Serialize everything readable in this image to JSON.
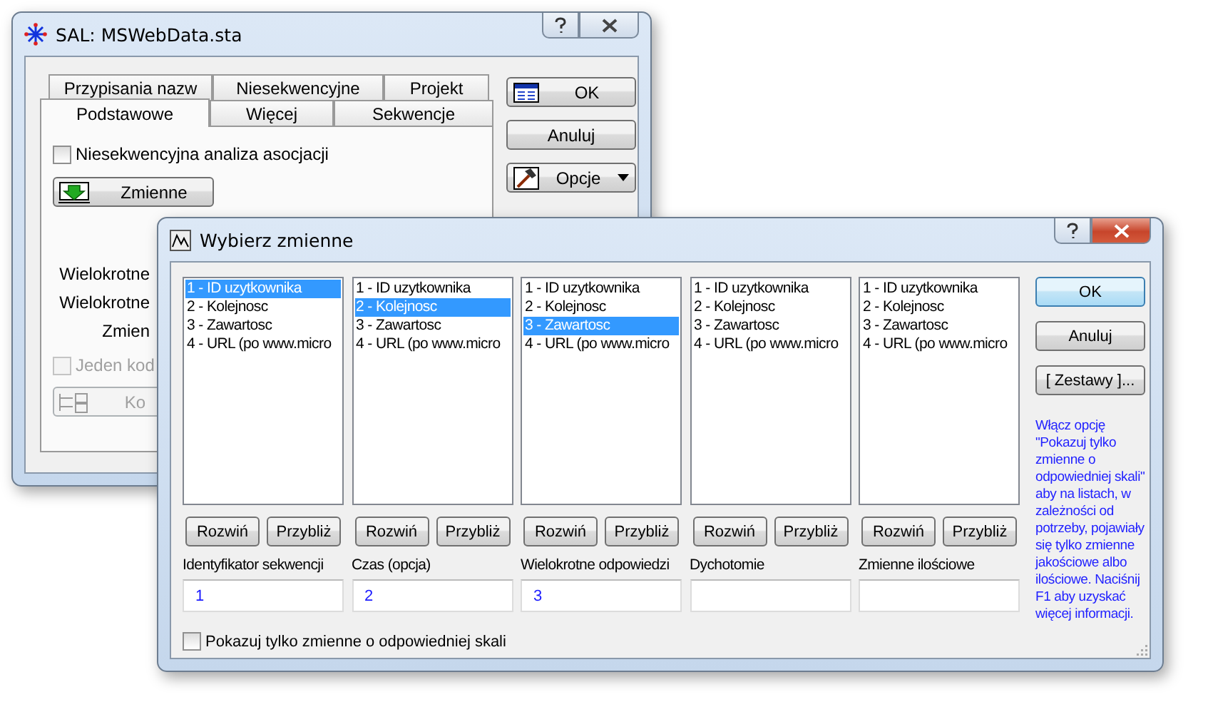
{
  "back_window": {
    "title": "SAL: MSWebData.sta",
    "tab_rows": [
      [
        {
          "label": "Przypisania nazw",
          "selected": false
        },
        {
          "label": "Niesekwencyjne",
          "selected": false
        },
        {
          "label": "Projekt",
          "selected": false
        }
      ],
      [
        {
          "label": "Podstawowe",
          "selected": true
        },
        {
          "label": "Więcej",
          "selected": false
        },
        {
          "label": "Sekwencje",
          "selected": false
        }
      ]
    ],
    "nonseq_checkbox": {
      "label": "Niesekwencyjna analiza asocjacji",
      "checked": false
    },
    "variables_button": {
      "label": "Zmienne"
    },
    "partial_labels": [
      "Wielokrotne",
      "Wielokrotne",
      "Zmien"
    ],
    "single_code_checkbox": {
      "label": "Jeden kod",
      "checked": false,
      "disabled": true
    },
    "code_button": {
      "label": "Ko",
      "disabled": true
    },
    "buttons": [
      {
        "label": "OK",
        "kind": "ok"
      },
      {
        "label": "Anuluj",
        "kind": "plain"
      },
      {
        "label": "Opcje",
        "kind": "dropdown"
      }
    ]
  },
  "front_window": {
    "title": "Wybierz zmienne",
    "lists": [
      {
        "items": [
          {
            "text": "1 - ID uzytkownika",
            "selected": true
          },
          {
            "text": "2 - Kolejnosc",
            "selected": false
          },
          {
            "text": "3 - Zawartosc",
            "selected": false
          },
          {
            "text": "4 - URL (po www.micro",
            "selected": false
          }
        ],
        "expand": "Rozwiń",
        "zoom": "Przybliż",
        "label": "Identyfikator sekwencji",
        "value": "1"
      },
      {
        "items": [
          {
            "text": "1 - ID uzytkownika",
            "selected": false
          },
          {
            "text": "2 - Kolejnosc",
            "selected": true
          },
          {
            "text": "3 - Zawartosc",
            "selected": false
          },
          {
            "text": "4 - URL (po www.micro",
            "selected": false
          }
        ],
        "expand": "Rozwiń",
        "zoom": "Przybliż",
        "label": "Czas (opcja)",
        "value": "2"
      },
      {
        "items": [
          {
            "text": "1 - ID uzytkownika",
            "selected": false
          },
          {
            "text": "2 - Kolejnosc",
            "selected": false
          },
          {
            "text": "3 - Zawartosc",
            "selected": true
          },
          {
            "text": "4 - URL (po www.micro",
            "selected": false
          }
        ],
        "expand": "Rozwiń",
        "zoom": "Przybliż",
        "label": "Wielokrotne odpowiedzi",
        "value": "3"
      },
      {
        "items": [
          {
            "text": "1 - ID uzytkownika",
            "selected": false
          },
          {
            "text": "2 - Kolejnosc",
            "selected": false
          },
          {
            "text": "3 - Zawartosc",
            "selected": false
          },
          {
            "text": "4 - URL (po www.micro",
            "selected": false
          }
        ],
        "expand": "Rozwiń",
        "zoom": "Przybliż",
        "label": "Dychotomie"
      },
      {
        "items": [
          {
            "text": "1 - ID uzytkownika",
            "selected": false
          },
          {
            "text": "2 - Kolejnosc",
            "selected": false
          },
          {
            "text": "3 - Zawartosc",
            "selected": false
          },
          {
            "text": "4 - URL (po www.micro",
            "selected": false
          }
        ],
        "expand": "Rozwiń",
        "zoom": "Przybliż",
        "label": "Zmienne ilościowe"
      }
    ],
    "scale_checkbox": {
      "label": "Pokazuj tylko zmienne o odpowiedniej skali",
      "checked": false
    },
    "buttons": [
      {
        "label": "OK",
        "kind": "default"
      },
      {
        "label": "Anuluj",
        "kind": "plain"
      },
      {
        "label": "[ Zestawy ]...",
        "kind": "plain"
      }
    ],
    "help_text": "Włącz opcję \"Pokazuj tylko zmienne o odpowiedniej skali\" aby na listach, w zależności od potrzeby, pojawiały się tylko zmienne jakościowe albo ilościowe. Naciśnij F1 aby uzyskać więcej informacji."
  }
}
